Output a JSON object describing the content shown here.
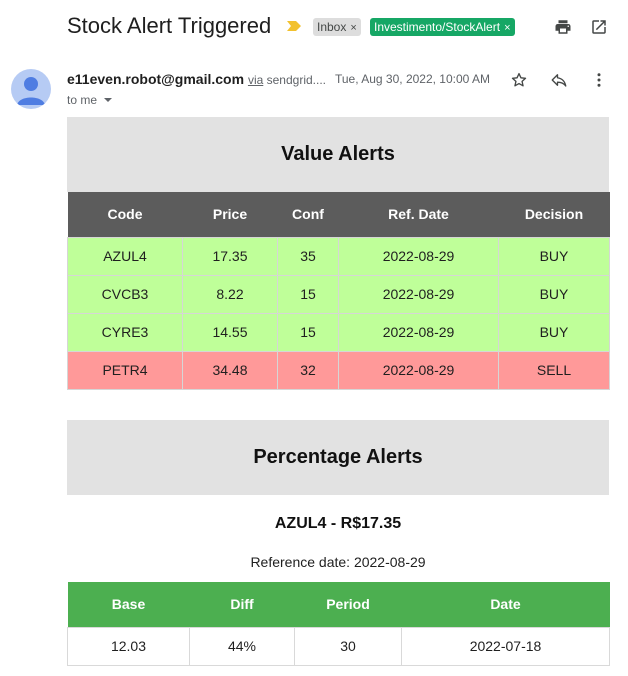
{
  "header": {
    "subject": "Stock Alert Triggered",
    "labels": [
      {
        "text": "Inbox",
        "close": "×"
      },
      {
        "text": "Investimento/StockAlert",
        "close": "×"
      }
    ]
  },
  "message": {
    "sender_email": "e11even.robot@gmail.com",
    "via_prefix": "via",
    "via_domain": "sendgrid....",
    "date": "Tue, Aug 30, 2022, 10:00 AM",
    "to": "to me"
  },
  "value_alerts": {
    "title": "Value Alerts",
    "columns": [
      "Code",
      "Price",
      "Conf",
      "Ref. Date",
      "Decision"
    ],
    "rows": [
      {
        "code": "AZUL4",
        "price": "17.35",
        "conf": "35",
        "ref_date": "2022-08-29",
        "decision": "BUY"
      },
      {
        "code": "CVCB3",
        "price": "8.22",
        "conf": "15",
        "ref_date": "2022-08-29",
        "decision": "BUY"
      },
      {
        "code": "CYRE3",
        "price": "14.55",
        "conf": "15",
        "ref_date": "2022-08-29",
        "decision": "BUY"
      },
      {
        "code": "PETR4",
        "price": "34.48",
        "conf": "32",
        "ref_date": "2022-08-29",
        "decision": "SELL"
      }
    ]
  },
  "percentage_alerts": {
    "title": "Percentage Alerts",
    "stock_title": "AZUL4 - R$17.35",
    "reference": "Reference date: 2022-08-29",
    "columns": [
      "Base",
      "Diff",
      "Period",
      "Date"
    ],
    "rows": [
      {
        "base": "12.03",
        "diff": "44%",
        "period": "30",
        "date": "2022-07-18"
      }
    ]
  },
  "colors": {
    "buy_row": "#bfff99",
    "sell_row": "#ff9999",
    "value_header": "#5c5c5c",
    "pct_header": "#4caf50",
    "label_green": "#16a765"
  },
  "icons": [
    "importance-marker-icon",
    "print-icon",
    "open-in-new-icon",
    "avatar-person-icon",
    "chevron-down-icon",
    "star-icon",
    "reply-icon",
    "more-vert-icon"
  ]
}
